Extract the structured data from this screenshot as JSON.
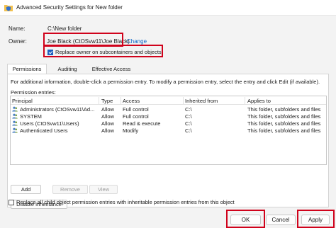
{
  "window": {
    "title": "Advanced Security Settings for New folder"
  },
  "name_row": {
    "label": "Name:",
    "value": "C:\\New folder"
  },
  "owner_row": {
    "label": "Owner:",
    "value": "Joe Black (CtOSvw11\\Joe Black)",
    "change_link": "Change"
  },
  "replace_owner": {
    "label": "Replace owner on subcontainers and objects",
    "checked": true
  },
  "tabs": [
    {
      "label": "Permissions",
      "active": true
    },
    {
      "label": "Auditing",
      "active": false
    },
    {
      "label": "Effective Access",
      "active": false
    }
  ],
  "permissions": {
    "info_text": "For additional information, double-click a permission entry. To modify a permission entry, select the entry and click Edit (if available).",
    "entries_label": "Permission entries:",
    "columns": [
      "Principal",
      "Type",
      "Access",
      "Inherited from",
      "Applies to"
    ],
    "rows": [
      {
        "principal": "Administrators (CtOSvw11\\Ad...",
        "type": "Allow",
        "access": "Full control",
        "inherited": "C:\\",
        "applies": "This folder, subfolders and files"
      },
      {
        "principal": "SYSTEM",
        "type": "Allow",
        "access": "Full control",
        "inherited": "C:\\",
        "applies": "This folder, subfolders and files"
      },
      {
        "principal": "Users (CtOSvw11\\Users)",
        "type": "Allow",
        "access": "Read & execute",
        "inherited": "C:\\",
        "applies": "This folder, subfolders and files"
      },
      {
        "principal": "Authenticated Users",
        "type": "Allow",
        "access": "Modify",
        "inherited": "C:\\",
        "applies": "This folder, subfolders and files"
      }
    ],
    "add_label": "Add",
    "remove_label": "Remove",
    "view_label": "View",
    "disable_inheritance_label": "Disable inheritance"
  },
  "replace_child": {
    "label": "Replace all child object permission entries with inheritable permission entries from this object",
    "checked": false
  },
  "footer": {
    "ok_label": "OK",
    "cancel_label": "Cancel",
    "apply_label": "Apply"
  },
  "colors": {
    "highlight": "#d0021b",
    "link": "#0a66c8",
    "checkbox_fill": "#1f5fbf"
  },
  "icons": {
    "window": "folder-shield-icon",
    "principal": "users-icon"
  }
}
